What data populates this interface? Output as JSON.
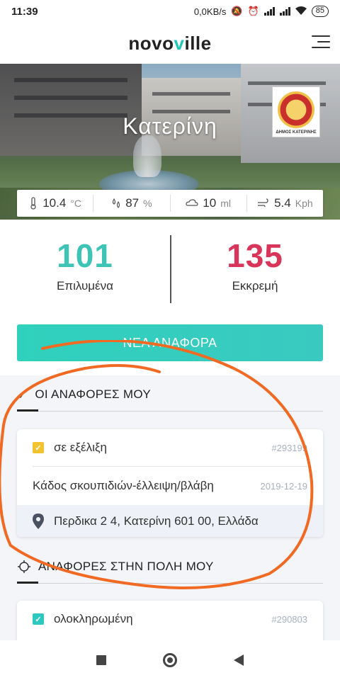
{
  "status_bar": {
    "time": "11:39",
    "network_speed": "0,0KB/s",
    "battery": "85"
  },
  "app": {
    "logo_prefix": "novo",
    "logo_highlight": "v",
    "logo_suffix": "ille"
  },
  "hero": {
    "city": "Κατερίνη",
    "emblem_caption": "ΔΗΜΟΣ ΚΑΤΕΡΙΝΗΣ"
  },
  "weather": {
    "temperature": "10.4",
    "temperature_unit": "°C",
    "humidity": "87",
    "humidity_unit": "%",
    "rain": "10",
    "rain_unit": "ml",
    "wind": "5.4",
    "wind_unit": "Kph"
  },
  "stats": {
    "resolved_count": "101",
    "resolved_label": "Επιλυμένα",
    "pending_count": "135",
    "pending_label": "Εκκρεμή"
  },
  "new_report_label": "ΝΕΑ ΑΝΑΦΟΡΑ",
  "my_reports": {
    "title": "ΟΙ ΑΝΑΦΟΡΕΣ ΜΟΥ",
    "card": {
      "status": "σε εξέλιξη",
      "id": "#293199",
      "category": "Κάδος σκουπιδιών-έλλειψη/βλάβη",
      "date": "2019-12-19",
      "address": "Περδικα 2 4, Κατερίνη 601 00, Ελλάδα"
    }
  },
  "city_reports": {
    "title": "ΑΝΑΦΟΡΕΣ ΣΤΗΝ ΠΟΛΗ ΜΟΥ",
    "card": {
      "status": "ολοκληρωμένη",
      "id": "#290803"
    }
  },
  "colors": {
    "accent": "#2fd1bd",
    "resolved": "#3dc4b6",
    "pending": "#d9355a",
    "in_progress": "#f2c230",
    "completed": "#2ec8c0",
    "annotation": "#f06a24"
  },
  "icons": [
    "menu-icon",
    "thermometer-icon",
    "humidity-icon",
    "rain-icon",
    "wind-icon",
    "checkmark-icon",
    "location-pin-icon",
    "city-icon",
    "square-icon",
    "circle-icon",
    "back-icon"
  ]
}
